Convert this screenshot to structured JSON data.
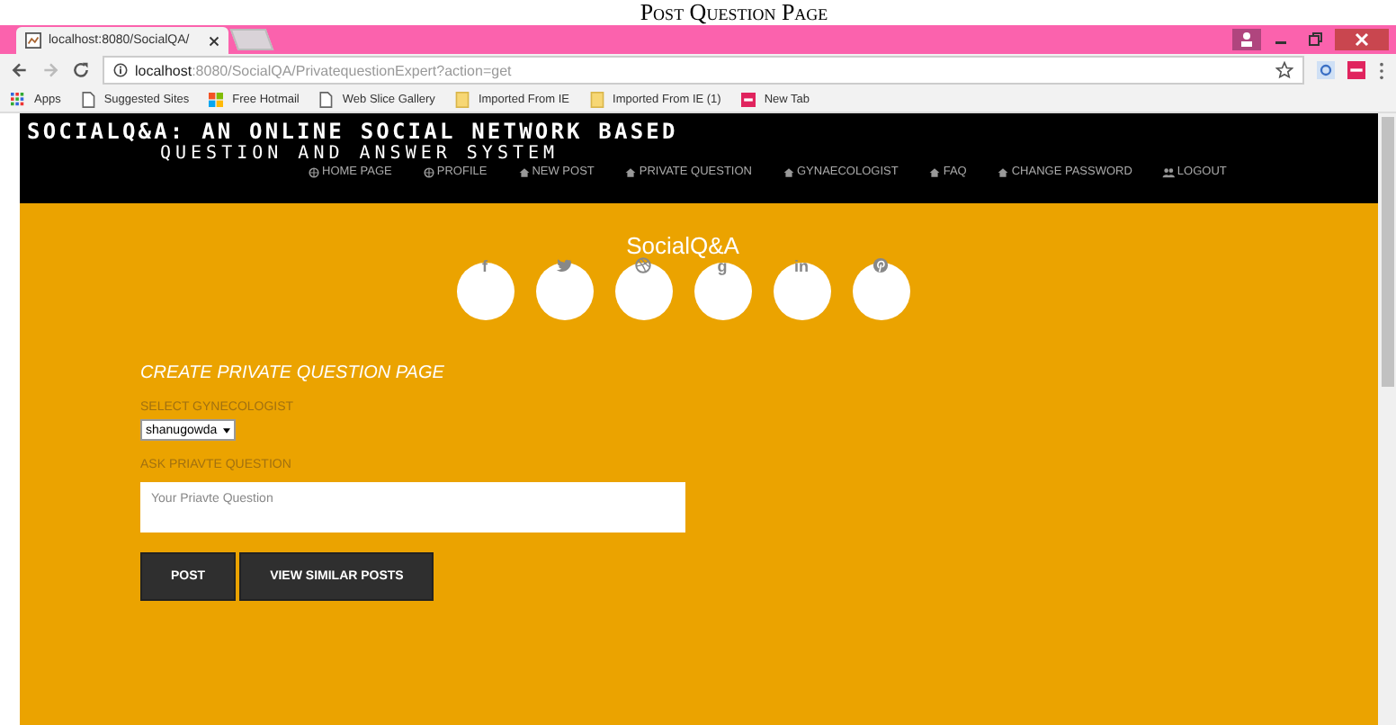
{
  "caption": "Post Question Page",
  "browser": {
    "tab_title": "localhost:8080/SocialQA/",
    "url_host": "localhost",
    "url_rest": ":8080/SocialQA/PrivatequestionExpert?action=get",
    "bookmarks": [
      {
        "kind": "apps",
        "label": "Apps"
      },
      {
        "kind": "page",
        "label": "Suggested Sites"
      },
      {
        "kind": "windows",
        "label": "Free Hotmail"
      },
      {
        "kind": "page",
        "label": "Web Slice Gallery"
      },
      {
        "kind": "folder",
        "label": "Imported From IE"
      },
      {
        "kind": "folder",
        "label": "Imported From IE (1)"
      },
      {
        "kind": "newtab",
        "label": "New Tab"
      }
    ]
  },
  "header": {
    "title_line1": "SOCIALQ&A: AN ONLINE SOCIAL NETWORK BASED",
    "title_line2": "QUESTION AND ANSWER SYSTEM",
    "nav": [
      {
        "kind": "globe",
        "label": "HOME PAGE"
      },
      {
        "kind": "globe",
        "label": "PROFILE"
      },
      {
        "kind": "house",
        "label": "NEW POST"
      },
      {
        "kind": "house",
        "label": "PRIVATE QUESTION"
      },
      {
        "kind": "house",
        "label": "GYNAECOLOGIST"
      },
      {
        "kind": "house",
        "label": "FAQ"
      },
      {
        "kind": "house",
        "label": "CHANGE PASSWORD"
      },
      {
        "kind": "users",
        "label": "LOGOUT"
      }
    ]
  },
  "brand": "SocialQ&A",
  "socials": [
    {
      "kind": "letter",
      "glyph": "f"
    },
    {
      "kind": "bird"
    },
    {
      "kind": "ball"
    },
    {
      "kind": "letter",
      "glyph": "g"
    },
    {
      "kind": "letter",
      "glyph": "in"
    },
    {
      "kind": "pin"
    }
  ],
  "form": {
    "heading": "CREATE PRIVATE QUESTION PAGE",
    "select_label": "SELECT GYNECOLOGIST",
    "select_value": "shanugowda",
    "question_label": "ASK PRIAVTE QUESTION",
    "question_placeholder": "Your Priavte Question",
    "buttons": [
      "POST",
      "VIEW SIMILAR POSTS"
    ]
  }
}
